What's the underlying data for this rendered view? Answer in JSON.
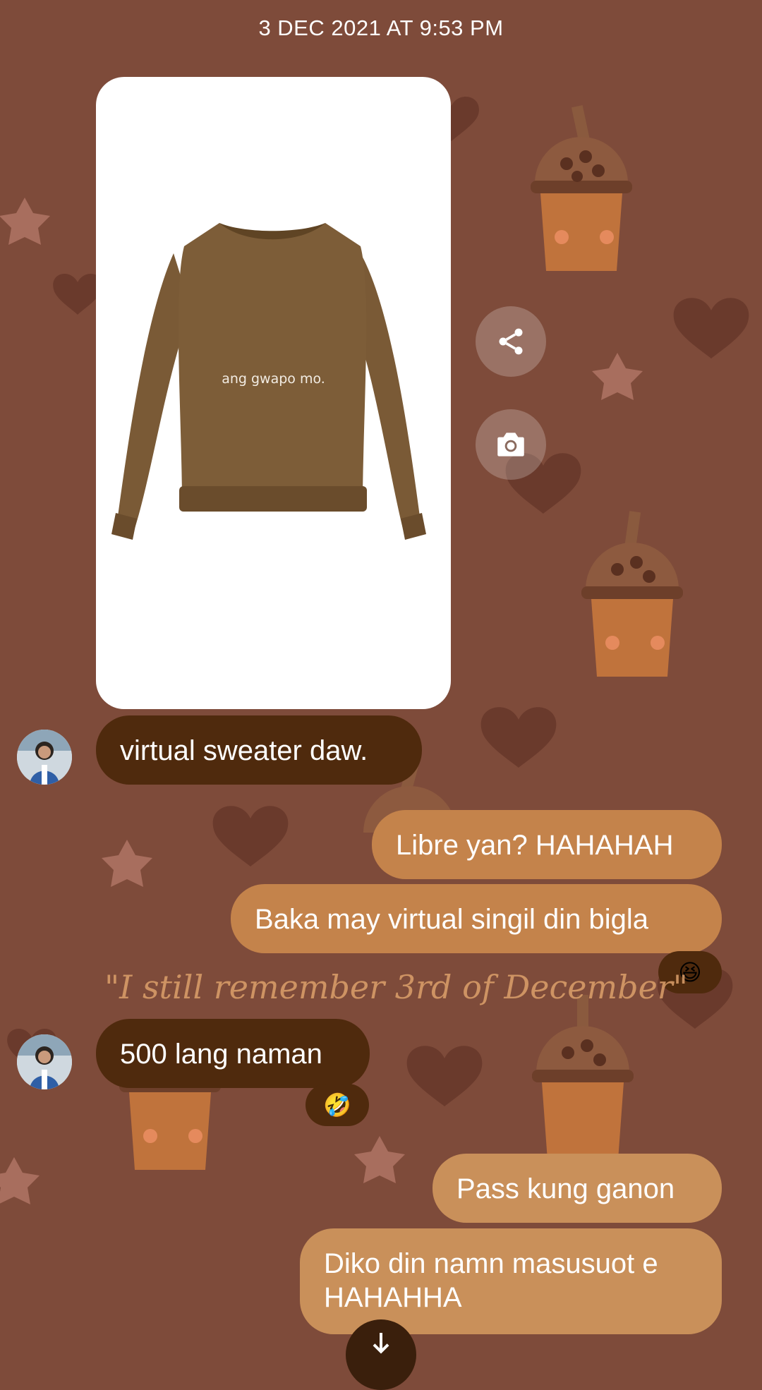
{
  "header": {
    "timestamp": "3 DEC 2021 AT 9:53 PM"
  },
  "image_message": {
    "overlay_text": "ang gwapo mo.",
    "actions": [
      {
        "name": "share-icon"
      },
      {
        "name": "camera-icon"
      }
    ]
  },
  "messages": [
    {
      "id": "m1",
      "direction": "incoming",
      "text": "virtual sweater daw."
    },
    {
      "id": "m2",
      "direction": "outgoing",
      "text": "Libre yan? HAHAHAH"
    },
    {
      "id": "m3",
      "direction": "outgoing",
      "text": "Baka may virtual singil din bigla",
      "reaction": "😆"
    },
    {
      "id": "m4",
      "direction": "incoming",
      "text": "500 lang naman",
      "reaction": "🤣"
    },
    {
      "id": "m5",
      "direction": "outgoing",
      "text": "Pass kung ganon"
    },
    {
      "id": "m6",
      "direction": "outgoing",
      "text": "Diko din namn masusuot e HAHAHHA"
    }
  ],
  "overlay_caption": "\"I still remember 3rd of December\"",
  "colors": {
    "background": "#7e4b3a",
    "incoming_bubble": "#4f2a0d",
    "outgoing_bubble": "#c4834b",
    "caption": "#dca06b"
  },
  "icons": {
    "scroll_down": "arrow-down-icon"
  }
}
